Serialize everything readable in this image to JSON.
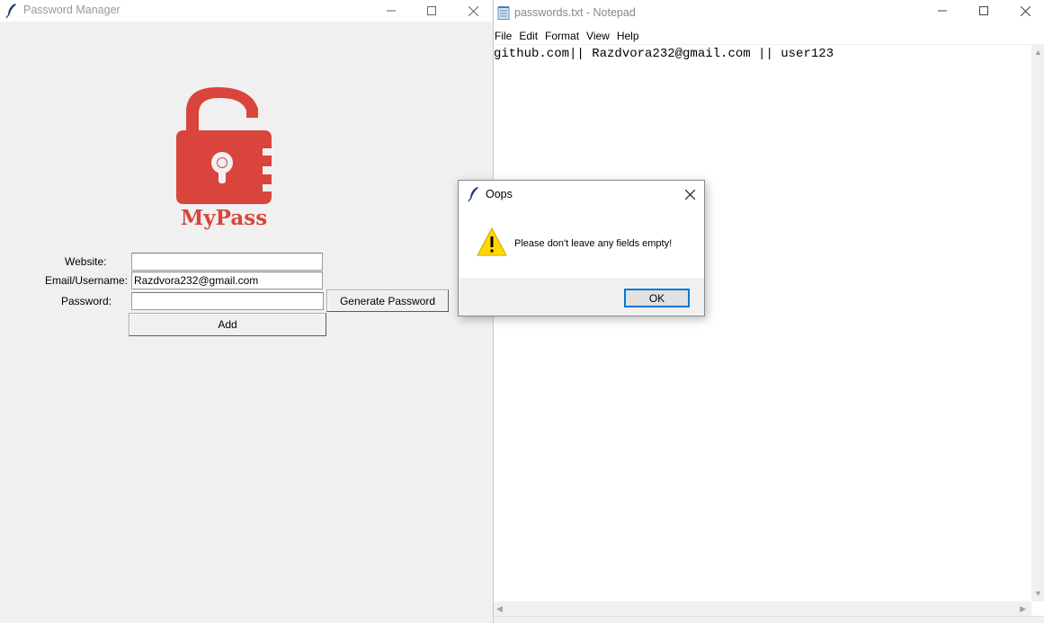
{
  "password_manager": {
    "title": "Password Manager",
    "logo_text": "MyPass",
    "brand_color": "#d9453c",
    "form": {
      "website_label": "Website:",
      "website_value": "",
      "email_label": "Email/Username:",
      "email_value": "Razdvora232@gmail.com",
      "password_label": "Password:",
      "password_value": "",
      "generate_label": "Generate Password",
      "add_label": "Add"
    }
  },
  "notepad": {
    "title": "passwords.txt - Notepad",
    "menu": [
      "File",
      "Edit",
      "Format",
      "View",
      "Help"
    ],
    "content": "github.com|| Razdvora232@gmail.com || user123"
  },
  "dialog": {
    "title": "Oops",
    "message": "Please don't leave any fields empty!",
    "ok_label": "OK",
    "icon": "warning-icon"
  }
}
